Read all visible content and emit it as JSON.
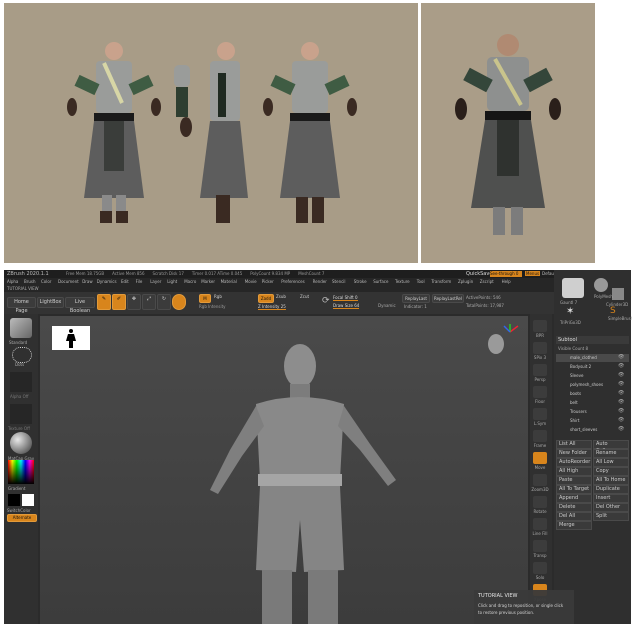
{
  "zbrush": {
    "title_bar": {
      "app": "ZBrush 2020.1.1",
      "stats": [
        "Free Mem 18.75GB",
        "Active Mem 856",
        "Scratch Disk 17",
        "Timer 0.017 ATime 0.045",
        "PolyCount 9.834 MP",
        "MeshCount 7"
      ],
      "quicksave": "QuickSave",
      "see_through": "See-through 0",
      "menus_label": "Menus",
      "script_label": "DefaultZScript"
    },
    "menu_bar": [
      "Alpha",
      "Brush",
      "Color",
      "Document",
      "Draw",
      "Dynamics",
      "Edit",
      "File",
      "Layer",
      "Light",
      "Macro",
      "Marker",
      "Material",
      "Movie",
      "Picker",
      "Preferences",
      "Render",
      "Stencil",
      "Stroke",
      "Surface",
      "Texture",
      "Tool",
      "Transform",
      "Zplugin",
      "Zscript",
      "Help"
    ],
    "tutorial_label": "TUTORIAL VIEW",
    "toolbar": {
      "home_page": "Home Page",
      "lightbox": "LightBox",
      "live_boolean": "Live Boolean",
      "edit": "Edit",
      "draw": "Draw",
      "move": "Move",
      "scale": "Scale",
      "rotate": "Rotate",
      "mrgb": "Mrgb",
      "rgb": "Rgb",
      "m": "M",
      "zadd": "Zadd",
      "zsub": "Zsub",
      "zcut": "Zcut",
      "rgb_intensity": "Rgb Intensity",
      "z_intensity": "Z Intensity 25",
      "focal_shift": "Focal Shift 0",
      "draw_size": "Draw Size 64",
      "dynamic": "Dynamic",
      "replay_last": "ReplayLast",
      "replay_last_rel": "ReplayLastRel",
      "active_points": "ActivePoints: 546",
      "total_points": "TotalPoints: 17,987",
      "indicator": "Indicator: 1"
    },
    "left_shelf": {
      "standard_label": "Standard",
      "dots_label": "Dots",
      "alpha_off": "Alpha Off",
      "texture_off": "Texture Off",
      "matcap": "MatCap Gray",
      "gradient": "Gradient",
      "switch_color": "SwitchColor",
      "alternate": "Alternate"
    },
    "right_shelf": [
      "BPR",
      "SPix 3",
      "Persp",
      "Floor",
      "L.Sym",
      "Frame",
      "Move",
      "Zoom3D",
      "Rotate",
      "Line Fill",
      "Transp",
      "Solo",
      "Xpose"
    ],
    "subtool": {
      "header": "Subtool",
      "visible_count": "Visible Count 8",
      "tools": [
        "Gauntl 7",
        "PolyMesh",
        "Cylinder3D",
        "SimpleBrush",
        "TriPriGo3D"
      ],
      "items": [
        "male_clothed",
        "Bodysuit 2",
        "Sleeve",
        "polymesh_shoes",
        "boots",
        "belt",
        "Trousers",
        "Shirt",
        "short_sleeves"
      ],
      "rows": [
        "List All",
        "Auto Collapse",
        "New Folder",
        "Rename",
        "AutoReorder",
        "All Low",
        "All High",
        "Copy",
        "Paste",
        "All To Home",
        "All To Target",
        "Duplicate",
        "Append",
        "Insert",
        "Delete",
        "Del Other",
        "Del All",
        "Split",
        "Merge"
      ]
    },
    "tooltip": {
      "title": "TUTORIAL VIEW",
      "line1": "Click and drag to reposition, or single click",
      "line2": "to restore previous position."
    }
  }
}
